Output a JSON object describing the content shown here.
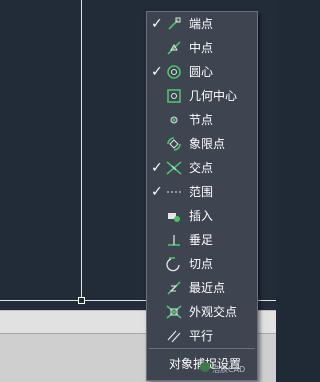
{
  "menu": {
    "items": [
      {
        "label": "端点",
        "checked": true,
        "icon": "endpoint-snap-icon"
      },
      {
        "label": "中点",
        "checked": false,
        "icon": "midpoint-snap-icon"
      },
      {
        "label": "圆心",
        "checked": true,
        "icon": "center-snap-icon"
      },
      {
        "label": "几何中心",
        "checked": false,
        "icon": "geometric-center-snap-icon"
      },
      {
        "label": "节点",
        "checked": false,
        "icon": "node-snap-icon"
      },
      {
        "label": "象限点",
        "checked": false,
        "icon": "quadrant-snap-icon"
      },
      {
        "label": "交点",
        "checked": true,
        "icon": "intersection-snap-icon"
      },
      {
        "label": "范围",
        "checked": true,
        "icon": "extension-snap-icon"
      },
      {
        "label": "插入",
        "checked": false,
        "icon": "insertion-snap-icon"
      },
      {
        "label": "垂足",
        "checked": false,
        "icon": "perpendicular-snap-icon"
      },
      {
        "label": "切点",
        "checked": false,
        "icon": "tangent-snap-icon"
      },
      {
        "label": "最近点",
        "checked": false,
        "icon": "nearest-snap-icon"
      },
      {
        "label": "外观交点",
        "checked": false,
        "icon": "apparent-intersection-snap-icon"
      },
      {
        "label": "平行",
        "checked": false,
        "icon": "parallel-snap-icon"
      }
    ],
    "footer_label": "对象捕捉设置",
    "check_glyph": "✓"
  },
  "watermark": {
    "text": "浩辰CAD"
  },
  "colors": {
    "canvas": "#222c39",
    "menu_bg": "#3e4450",
    "snap_green": "#46c46a",
    "text": "#ffffff"
  }
}
